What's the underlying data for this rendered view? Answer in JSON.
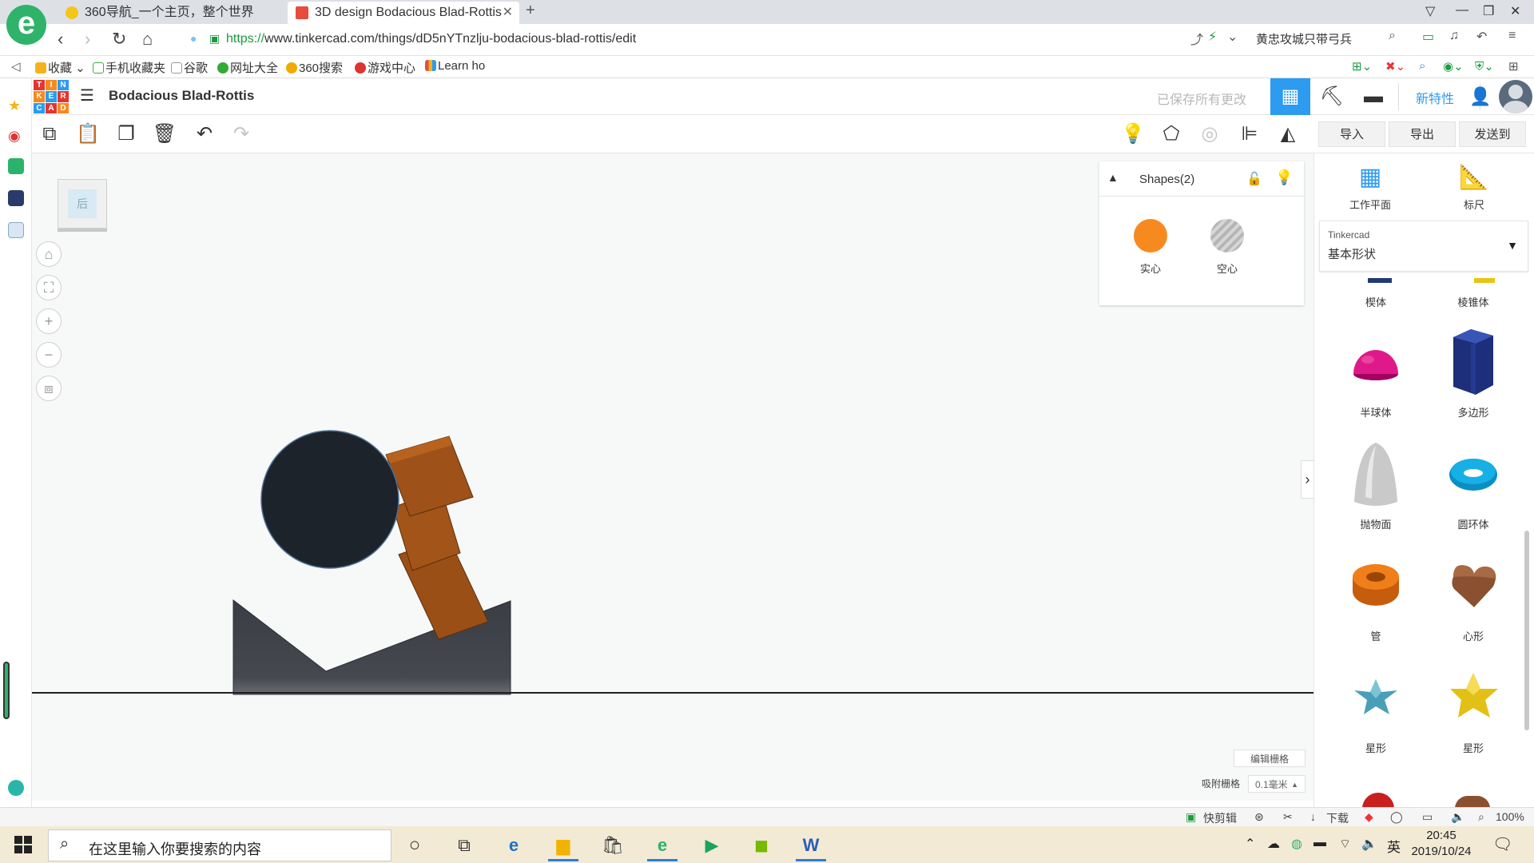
{
  "browser": {
    "tabs": [
      {
        "title": "360导航_一个主页，整个世界",
        "active": false
      },
      {
        "title": "3D design Bodacious Blad-Rottis",
        "active": true
      }
    ],
    "url_scheme": "https://",
    "url_rest": "www.tinkercad.com/things/dD5nYTnzlju-bodacious-blad-rottis/edit",
    "search_text": "黄忠攻城只带弓兵",
    "bookmarks": [
      "收藏",
      "手机收藏夹",
      "谷歌",
      "网址大全",
      "360搜索",
      "游戏中心",
      "Learn ho"
    ]
  },
  "app": {
    "logo_letters": [
      "T",
      "I",
      "N",
      "K",
      "E",
      "R",
      "C",
      "A",
      "D"
    ],
    "design_title": "Bodacious Blad-Rottis",
    "saved_status": "已保存所有更改",
    "whats_new": "新特性",
    "toolbar_right": {
      "import": "导入",
      "export": "导出",
      "send_to": "发送到"
    },
    "viewcube_face": "后",
    "shape_panel": {
      "title": "Shapes(2)",
      "solid_label": "实心",
      "hole_label": "空心",
      "solid_color": "#f78a1f"
    },
    "side_tools": {
      "workplane": "工作平面",
      "ruler": "标尺"
    },
    "library": {
      "source": "Tinkercad",
      "category": "基本形状"
    },
    "shapes": [
      {
        "label": "楔体"
      },
      {
        "label": "棱锥体"
      },
      {
        "label": "半球体"
      },
      {
        "label": "多边形"
      },
      {
        "label": "抛物面"
      },
      {
        "label": "圆环体"
      },
      {
        "label": "管"
      },
      {
        "label": "心形"
      },
      {
        "label": "星形"
      },
      {
        "label": "星形"
      }
    ],
    "grid": {
      "edit_label": "编辑栅格",
      "snap_label": "吸附栅格",
      "snap_value": "0.1毫米"
    }
  },
  "statusbar": {
    "clip": "快剪辑",
    "download": "下载",
    "zoom": "100%"
  },
  "taskbar": {
    "search_placeholder": "在这里输入你要搜索的内容",
    "ime": "英",
    "time": "20:45",
    "date": "2019/10/24"
  },
  "colors": {
    "accent": "#2d9bf0",
    "ground": "#222222",
    "ball": "#1d232b",
    "arm": "#a0521a",
    "base": "#3f4348"
  }
}
